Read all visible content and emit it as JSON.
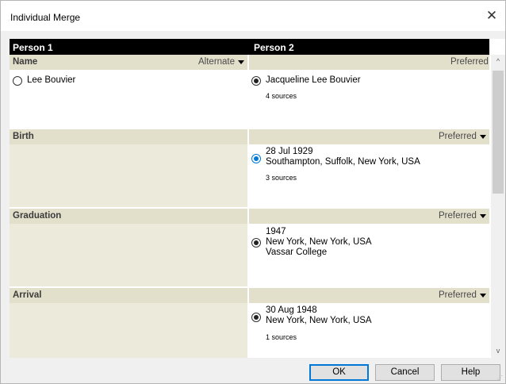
{
  "window": {
    "title": "Individual Merge",
    "close_glyph": "✕"
  },
  "columns": {
    "person1": "Person 1",
    "person2": "Person 2"
  },
  "sections": {
    "name": {
      "label": "Name",
      "left_option": "Alternate",
      "right_option": "Preferred",
      "left": {
        "line1": "Lee Bouvier"
      },
      "right": {
        "line1": "Jacqueline Lee Bouvier",
        "sources": "4 sources"
      }
    },
    "birth": {
      "label": "Birth",
      "right_option": "Preferred",
      "right": {
        "line1": "28 Jul 1929",
        "line2": "Southampton, Suffolk, New York, USA",
        "sources": "3 sources"
      }
    },
    "graduation": {
      "label": "Graduation",
      "right_option": "Preferred",
      "right": {
        "line1": "1947",
        "line2": "New York, New York, USA",
        "line3": "Vassar College"
      }
    },
    "arrival": {
      "label": "Arrival",
      "right_option": "Preferred",
      "right": {
        "line1": "30 Aug 1948",
        "line2": "New York, New York, USA",
        "sources": "1 sources"
      }
    }
  },
  "scrollbar": {
    "up_icon": "chevron-up-icon",
    "down_icon": "chevron-down-icon",
    "up_glyph": "^",
    "down_glyph": "v"
  },
  "buttons": {
    "ok": "OK",
    "cancel": "Cancel",
    "help": "Help"
  },
  "colors": {
    "header_bg": "#000000",
    "section_bg": "#e2dfcb",
    "left_body_bg": "#eceadb",
    "accent": "#0078d7"
  }
}
